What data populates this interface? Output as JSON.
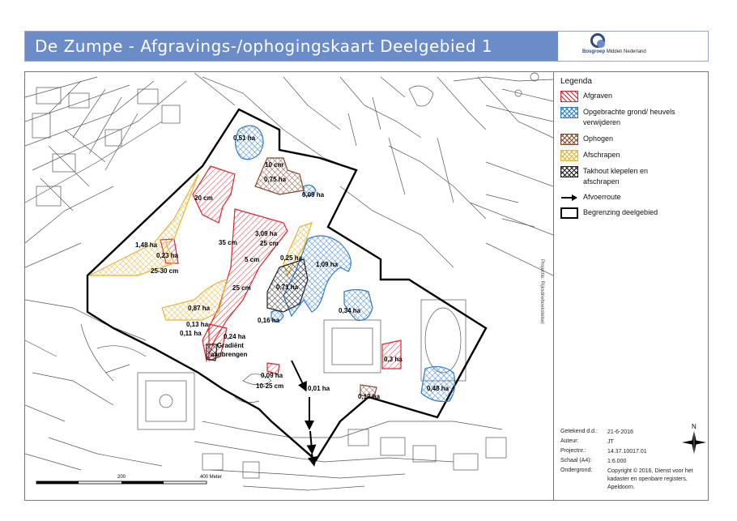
{
  "header": {
    "title": "De Zumpe - Afgravings-/ophogingskaart Deelgebied 1",
    "logo_name": "Bosgroep",
    "logo_sub": "Midden Nederland"
  },
  "legend": {
    "title": "Legenda",
    "items": [
      {
        "label": "Afgraven",
        "color": "#e0232b",
        "pattern": "hatch"
      },
      {
        "label": "Opgebrachte grond/ heuvels verwijderen",
        "color": "#2a7bd8",
        "pattern": "cross"
      },
      {
        "label": "Ophogen",
        "color": "#8b4a2e",
        "pattern": "cross"
      },
      {
        "label": "Afschrapen",
        "color": "#e8b432",
        "pattern": "cross"
      },
      {
        "label": "Takhout klepelen en afschrapen",
        "color": "#222222",
        "pattern": "cross"
      },
      {
        "label": "Afvoerroute",
        "pattern": "arrow"
      },
      {
        "label": "Begrenzing deelgebied",
        "pattern": "outline"
      }
    ]
  },
  "projection": "Projectie: Rijksdriehoekstelsel",
  "meta": [
    {
      "key": "Getekend d.d.:",
      "value": "21-6-2016"
    },
    {
      "key": "Auteur:",
      "value": "JT"
    },
    {
      "key": "Projectnr.:",
      "value": "14.37.10017.01"
    },
    {
      "key": "Schaal (A4):",
      "value": "1:6.000"
    },
    {
      "key": "Ondergrond:",
      "value": "Copyright © 2016, Dienst voor het kadaster en openbare registers, Apeldoorn."
    }
  ],
  "north_label": "N",
  "scale_labels": [
    "200",
    "400 Meter"
  ],
  "map_labels": {
    "a051": "0,51 ha",
    "a10cm": "10 cm",
    "a075": "0,75 ha",
    "a009": "0,09 ha",
    "a20cm": "20 cm",
    "a309": "3,09 ha",
    "a25cm": "25 cm",
    "a35cm": "35 cm",
    "a5cm": "5 cm",
    "a148": "1,48 ha",
    "a023": "0,23 ha",
    "a2530": "25-30 cm",
    "a025": "0,25 ha",
    "a109": "1,09 ha",
    "a071": "0,71 ha",
    "a25cm2": "25 cm",
    "a087": "0,87 ha",
    "a013a": "0,13 ha",
    "a011": "0,11 ha",
    "a024": "0,24 ha",
    "a016": "0,16 ha",
    "a034": "0,34 ha",
    "grad1": "Gradiënt",
    "grad2": "aanbrengen",
    "a03": "0,3 ha",
    "a009b": "0,09 ha",
    "a1025": "10-25 cm",
    "a001": "0,01 ha",
    "a013b": "0,13 ha",
    "a048": "0,48 ha"
  }
}
